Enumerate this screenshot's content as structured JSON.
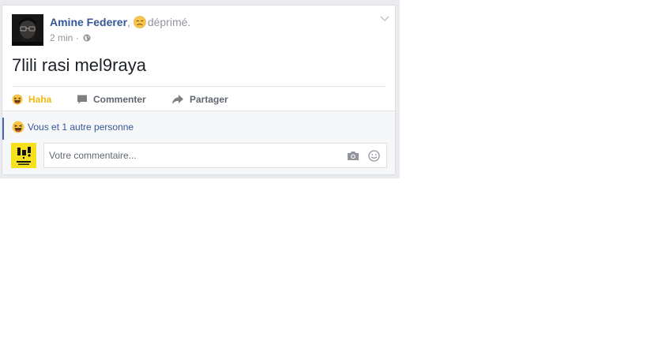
{
  "post": {
    "author": "Amine Federer",
    "separator": ",",
    "feeling_icon": "unamused-face-emoji",
    "feeling": "déprimé.",
    "timestamp": "2 min",
    "meta_sep": "·",
    "privacy_icon": "globe-icon",
    "text": "7lili rasi mel9raya"
  },
  "actions": {
    "haha": "Haha",
    "comment": "Commenter",
    "share": "Partager"
  },
  "reactions": {
    "summary": "Vous et 1 autre personne",
    "icon": "haha-emoji"
  },
  "comment_box": {
    "placeholder": "Votre commentaire...",
    "camera_icon": "camera-icon",
    "emoji_icon": "smiley-icon"
  },
  "colors": {
    "link": "#365899",
    "haha": "#f0ba15",
    "muted": "#90949c",
    "accent": "#4267b2"
  }
}
